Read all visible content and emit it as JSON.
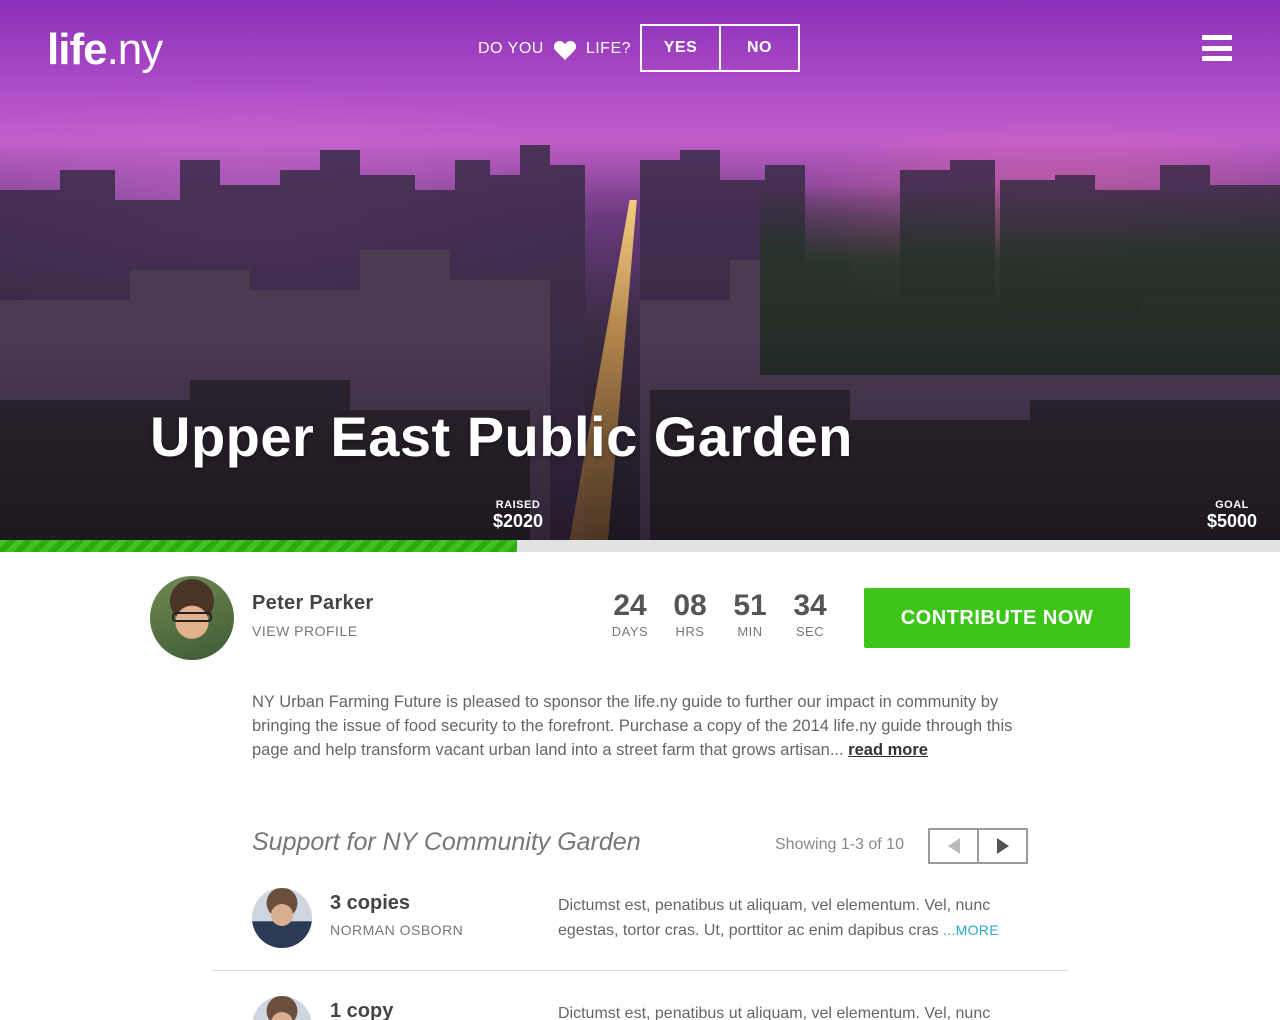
{
  "header": {
    "logo_bold": "life",
    "logo_light": ".ny",
    "prompt_before": "DO YOU",
    "prompt_after": "LIFE?",
    "yes_label": "YES",
    "no_label": "NO",
    "menu_icon": "hamburger-icon"
  },
  "hero": {
    "title": "Upper East Public Garden",
    "raised_label": "RAISED",
    "raised_value": "$2020",
    "goal_label": "GOAL",
    "goal_value": "$5000",
    "progress_fraction": 0.404
  },
  "owner": {
    "name": "Peter Parker",
    "profile_link": "VIEW PROFILE"
  },
  "countdown": [
    {
      "value": "24",
      "unit": "DAYS"
    },
    {
      "value": "08",
      "unit": "HRS"
    },
    {
      "value": "51",
      "unit": "MIN"
    },
    {
      "value": "34",
      "unit": "SEC"
    }
  ],
  "cta": {
    "label": "CONTRIBUTE NOW"
  },
  "description": {
    "text": "NY Urban Farming Future is pleased to sponsor the life.ny guide to further our impact in community by bringing the issue of food security to the forefront. Purchase a copy of the 2014 life.ny guide through this page and help transform vacant urban land into a street farm that grows artisan...",
    "more": "read more"
  },
  "support": {
    "title": "Support for NY Community Garden",
    "showing": "Showing 1-3 of 10",
    "items": [
      {
        "qty": "3 copies",
        "name": "NORMAN OSBORN",
        "message": "Dictumst est, penatibus ut aliquam, vel elementum. Vel, nunc egestas, tortor cras. Ut, porttitor ac enim dapibus cras",
        "more": "...MORE"
      },
      {
        "qty": "1 copy",
        "name": "",
        "message": "Dictumst est, penatibus ut aliquam, vel elementum. Vel, nunc",
        "more": ""
      }
    ]
  },
  "colors": {
    "accent_green": "#3dc519",
    "link_blue": "#29aacc",
    "hero_purple": "#8a2fb8"
  }
}
